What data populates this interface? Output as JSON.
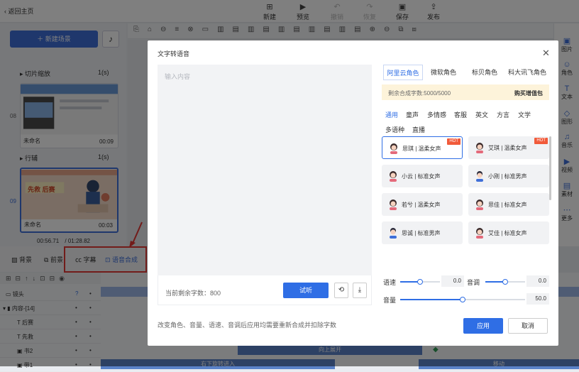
{
  "topbar": {
    "back": "返回主页",
    "tools": [
      {
        "icon": "plus-square-icon",
        "label": "新建",
        "disabled": false
      },
      {
        "icon": "play-icon",
        "label": "预览",
        "disabled": false
      },
      {
        "icon": "undo-icon",
        "label": "撤销",
        "disabled": true
      },
      {
        "icon": "redo-icon",
        "label": "恢复",
        "disabled": true
      },
      {
        "icon": "save-icon",
        "label": "保存",
        "disabled": false
      },
      {
        "icon": "publish-icon",
        "label": "发布",
        "disabled": false
      }
    ]
  },
  "left": {
    "new_scene": "＋ 新建场景",
    "rows": [
      {
        "label": "切片缩放",
        "dur": "1(s)"
      },
      {
        "label": "行辅",
        "dur": "1(s)"
      }
    ],
    "scenes": [
      {
        "num": "08",
        "name": "未命名",
        "time": "00:09"
      },
      {
        "num": "09",
        "name": "未命名",
        "time": "00:03",
        "thumb_text": "先救 后赛"
      }
    ],
    "time_current": "00:56.71",
    "time_total": "/ 01:28.82"
  },
  "rightbar": [
    {
      "label": "图片",
      "icon": "image-icon"
    },
    {
      "label": "角色",
      "icon": "character-icon"
    },
    {
      "label": "文本",
      "icon": "text-icon"
    },
    {
      "label": "图形",
      "icon": "shape-icon"
    },
    {
      "label": "音乐",
      "icon": "music-icon"
    },
    {
      "label": "视频",
      "icon": "video-icon"
    },
    {
      "label": "素材",
      "icon": "material-icon"
    },
    {
      "label": "更多",
      "icon": "more-icon"
    }
  ],
  "bottom_tabs": [
    "背景",
    "前景",
    "字幕",
    "语音合成"
  ],
  "timeline": {
    "rows": [
      {
        "label": "镜头",
        "type": "camera-icon"
      },
      {
        "label": "内容-[14]",
        "type": "folder-icon"
      },
      {
        "label": "后赛",
        "type": "text-icon"
      },
      {
        "label": "先救",
        "type": "text-icon"
      },
      {
        "label": "书2",
        "type": "image-icon"
      },
      {
        "label": "带1",
        "type": "image-icon"
      }
    ],
    "tracks": [
      "向上展开",
      "右下旋转进入",
      "移动"
    ]
  },
  "modal": {
    "title": "文字转语音",
    "placeholder": "输入内容",
    "remaining": "当前剩余字数：800",
    "try": "试听",
    "note": "改变角色、音量、语速、音调后应用均需要重新合成并扣除字数",
    "voice_tabs": [
      "阿里云角色",
      "微软角色",
      "标贝角色",
      "科大讯飞角色"
    ],
    "quota": "剩余合成字数:5000/5000",
    "buy": "购买增值包",
    "categories": [
      "通用",
      "童声",
      "多情感",
      "客服",
      "英文",
      "方言",
      "文学",
      "多语种",
      "直播"
    ],
    "voices": [
      {
        "name": "思琪 | 温柔女声",
        "hot": "HOT",
        "gender": "f"
      },
      {
        "name": "艾琪 | 温柔女声",
        "hot": "HOT",
        "gender": "f"
      },
      {
        "name": "小云 | 标准女声",
        "hot": "",
        "gender": "f"
      },
      {
        "name": "小刚 | 标准男声",
        "hot": "",
        "gender": "m"
      },
      {
        "name": "若兮 | 温柔女声",
        "hot": "",
        "gender": "f"
      },
      {
        "name": "思佳 | 标准女声",
        "hot": "",
        "gender": "f"
      },
      {
        "name": "思诚 | 标准男声",
        "hot": "",
        "gender": "m"
      },
      {
        "name": "艾佳 | 标准女声",
        "hot": "",
        "gender": "f"
      }
    ],
    "speed_label": "语速",
    "speed_value": "0.0",
    "speed_level": 0.5,
    "pitch_label": "音调",
    "pitch_value": "0.0",
    "pitch_level": 0.5,
    "volume_label": "音量",
    "volume_value": "50.0",
    "volume_level": 0.5,
    "apply": "应用",
    "cancel": "取消"
  }
}
